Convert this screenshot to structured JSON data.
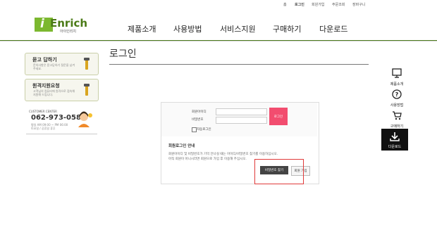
{
  "util_menu": [
    "홈",
    "로그인",
    "회원가입",
    "주문조회",
    "장바구니"
  ],
  "logo": {
    "text": "Enrich",
    "i": "i",
    "sub": "아이인리치"
  },
  "nav": [
    "제품소개",
    "사용방법",
    "서비스지원",
    "구매하기",
    "다운로드"
  ],
  "sidebar": {
    "cards": [
      {
        "title": "묻고 답하기",
        "desc": "문의사항은 묻고답하기 질문을 남겨주세요."
      },
      {
        "title": "원격지원요청",
        "desc": "고객님의 컴퓨터에 원격으로 접속해 지원해 드립니다."
      }
    ],
    "customer_center": {
      "label": "CUSTOMER CENTER",
      "phone": "062-973-0580",
      "hours": "평일 AM 09:00 ~ PM 06:00",
      "hours2": "토요일 / 공휴일 휴무"
    }
  },
  "page": {
    "title": "로그인"
  },
  "login": {
    "id_label": "회원아이디",
    "pw_label": "비밀번호",
    "login_button": "로그인",
    "auto_login": "자동로그인"
  },
  "member_info": {
    "title": "회원로그인 안내",
    "line1": "회원아이디 및 비밀번호가 기억 안나실 때는 아이디/비밀번호 찾기를 이용하십시오.",
    "line2": "아직 회원이 아니시라면 회원으로 가입 후 이용해 주십시오.",
    "find_button": "비밀번호 찾기",
    "join_button": "회원 가입"
  },
  "quick_menu": [
    {
      "label": "제품소개",
      "icon": "monitor-icon"
    },
    {
      "label": "사용방법",
      "icon": "question-icon"
    },
    {
      "label": "구매하기",
      "icon": "cart-icon"
    },
    {
      "label": "다운로드",
      "icon": "download-icon"
    }
  ],
  "colors": {
    "brand_green": "#7cb82f",
    "login_pink": "#f24d6f",
    "highlight_red": "#e03a3a"
  }
}
